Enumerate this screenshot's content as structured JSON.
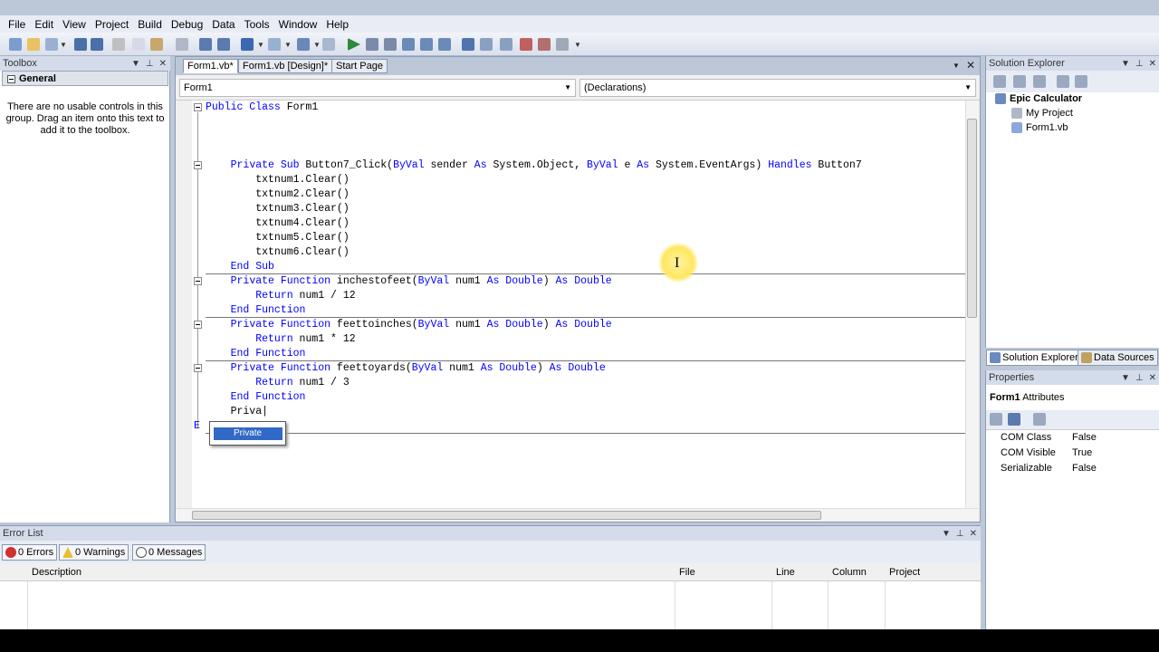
{
  "menu": [
    "File",
    "Edit",
    "View",
    "Project",
    "Build",
    "Debug",
    "Data",
    "Tools",
    "Window",
    "Help"
  ],
  "toolbox": {
    "title": "Toolbox",
    "group": "General",
    "message": "There are no usable controls in this group. Drag an item onto this text to add it to the toolbox."
  },
  "editor": {
    "tabs": [
      "Form1.vb*",
      "Form1.vb [Design]*",
      "Start Page"
    ],
    "class_combo": "Form1",
    "member_combo": "(Declarations)",
    "intellisense_item": "Private"
  },
  "solution_explorer": {
    "title": "Solution Explorer",
    "root": "Epic Calculator",
    "items": [
      "My Project",
      "Form1.vb"
    ],
    "tab_solution": "Solution Explorer",
    "tab_data": "Data Sources"
  },
  "properties": {
    "title": "Properties",
    "object_name": "Form1",
    "object_type": "Attributes",
    "rows": [
      {
        "name": "COM Class",
        "value": "False"
      },
      {
        "name": "COM Visible",
        "value": "True"
      },
      {
        "name": "Serializable",
        "value": "False"
      }
    ]
  },
  "error_list": {
    "title": "Error List",
    "errors": "0 Errors",
    "warnings": "0 Warnings",
    "messages": "0 Messages",
    "columns": [
      "Description",
      "File",
      "Line",
      "Column",
      "Project"
    ]
  }
}
